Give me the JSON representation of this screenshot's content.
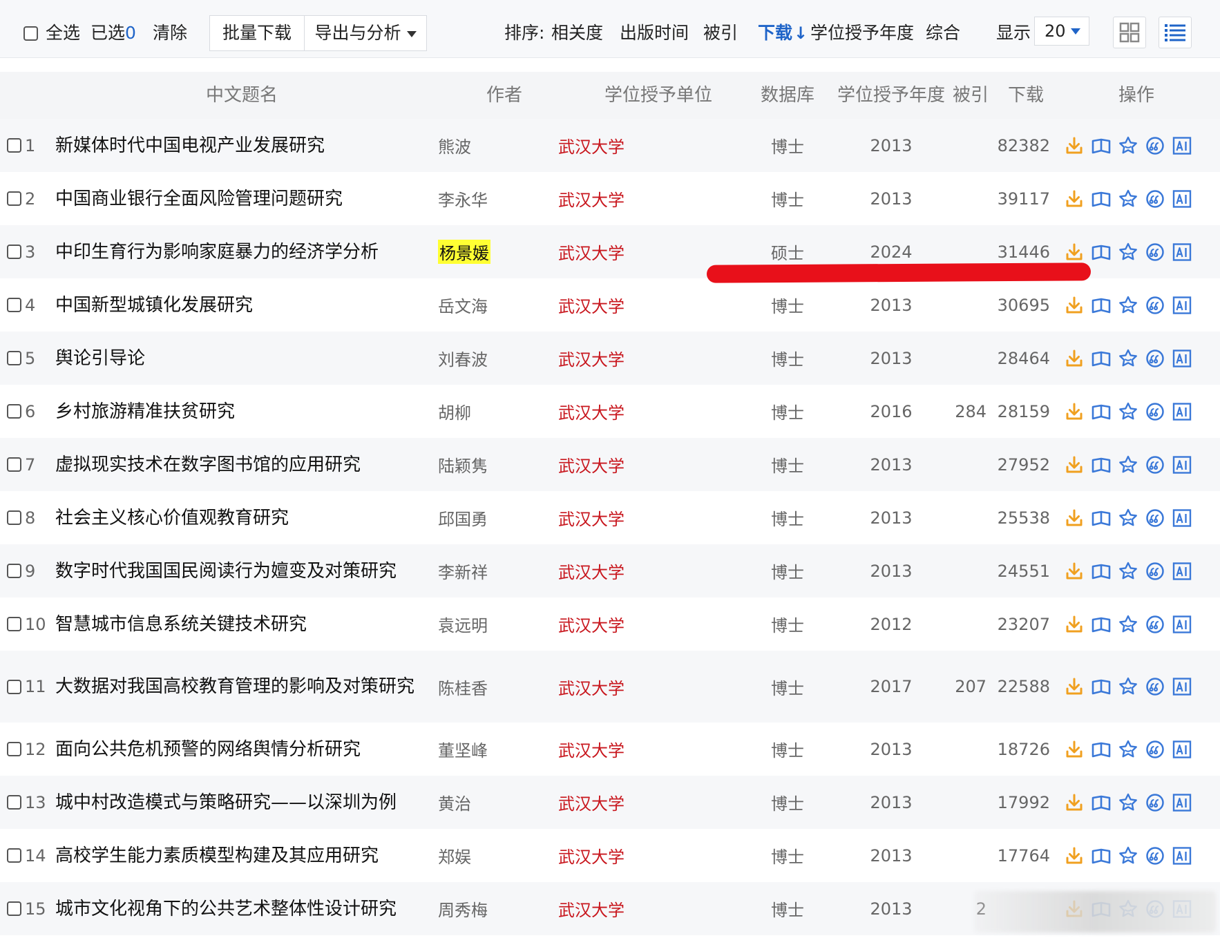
{
  "toolbar": {
    "select_all": "全选",
    "selected_label": "已选",
    "selected_count": "0",
    "clear": "清除",
    "batch_download": "批量下载",
    "export_analyze": "导出与分析",
    "sort_label": "排序:",
    "sort_options": [
      "相关度",
      "出版时间",
      "被引",
      "下载",
      "学位授予年度",
      "综合"
    ],
    "sort_active": "下载",
    "display_label": "显示",
    "page_size": "20",
    "grid_view_icon": "grid-view-icon",
    "list_view_icon": "list-view-icon"
  },
  "table": {
    "headers": {
      "title": "中文题名",
      "author": "作者",
      "unit": "学位授予单位",
      "db": "数据库",
      "year": "学位授予年度",
      "cited": "被引",
      "downloads": "下载",
      "ops": "操作"
    },
    "rows": [
      {
        "num": "1",
        "title": "新媒体时代中国电视产业发展研究",
        "author": "熊波",
        "unit": "武汉大学",
        "db": "博士",
        "year": "2013",
        "cited": "",
        "downloads": "82382"
      },
      {
        "num": "2",
        "title": "中国商业银行全面风险管理问题研究",
        "author": "李永华",
        "unit": "武汉大学",
        "db": "博士",
        "year": "2013",
        "cited": "",
        "downloads": "39117"
      },
      {
        "num": "3",
        "title": "中印生育行为影响家庭暴力的经济学分析",
        "author": "杨景媛",
        "unit": "武汉大学",
        "db": "硕士",
        "year": "2024",
        "cited": "",
        "downloads": "31446"
      },
      {
        "num": "4",
        "title": "中国新型城镇化发展研究",
        "author": "岳文海",
        "unit": "武汉大学",
        "db": "博士",
        "year": "2013",
        "cited": "",
        "downloads": "30695"
      },
      {
        "num": "5",
        "title": "舆论引导论",
        "author": "刘春波",
        "unit": "武汉大学",
        "db": "博士",
        "year": "2013",
        "cited": "",
        "downloads": "28464"
      },
      {
        "num": "6",
        "title": "乡村旅游精准扶贫研究",
        "author": "胡柳",
        "unit": "武汉大学",
        "db": "博士",
        "year": "2016",
        "cited": "284",
        "downloads": "28159"
      },
      {
        "num": "7",
        "title": "虚拟现实技术在数字图书馆的应用研究",
        "author": "陆颖隽",
        "unit": "武汉大学",
        "db": "博士",
        "year": "2013",
        "cited": "",
        "downloads": "27952"
      },
      {
        "num": "8",
        "title": "社会主义核心价值观教育研究",
        "author": "邱国勇",
        "unit": "武汉大学",
        "db": "博士",
        "year": "2013",
        "cited": "",
        "downloads": "25538"
      },
      {
        "num": "9",
        "title": "数字时代我国国民阅读行为嬗变及对策研究",
        "author": "李新祥",
        "unit": "武汉大学",
        "db": "博士",
        "year": "2013",
        "cited": "",
        "downloads": "24551"
      },
      {
        "num": "10",
        "title": "智慧城市信息系统关键技术研究",
        "author": "袁远明",
        "unit": "武汉大学",
        "db": "博士",
        "year": "2012",
        "cited": "",
        "downloads": "23207"
      },
      {
        "num": "11",
        "title": "大数据对我国高校教育管理的影响及对策研究",
        "author": "陈桂香",
        "unit": "武汉大学",
        "db": "博士",
        "year": "2017",
        "cited": "207",
        "downloads": "22588"
      },
      {
        "num": "12",
        "title": "面向公共危机预警的网络舆情分析研究",
        "author": "董坚峰",
        "unit": "武汉大学",
        "db": "博士",
        "year": "2013",
        "cited": "",
        "downloads": "18726"
      },
      {
        "num": "13",
        "title": "城中村改造模式与策略研究——以深圳为例",
        "author": "黄治",
        "unit": "武汉大学",
        "db": "博士",
        "year": "2013",
        "cited": "",
        "downloads": "17992"
      },
      {
        "num": "14",
        "title": "高校学生能力素质模型构建及其应用研究",
        "author": "郑娱",
        "unit": "武汉大学",
        "db": "博士",
        "year": "2013",
        "cited": "",
        "downloads": "17764"
      },
      {
        "num": "15",
        "title": "城市文化视角下的公共艺术整体性设计研究",
        "author": "周秀梅",
        "unit": "武汉大学",
        "db": "博士",
        "year": "2013",
        "cited": "2",
        "downloads": ""
      }
    ],
    "highlighted_author_row": 3,
    "op_icons": [
      "download-icon",
      "read-icon",
      "favorite-icon",
      "cite-icon",
      "ai-icon"
    ]
  },
  "colors": {
    "accent": "#1f64c8",
    "unit_red": "#c8161d",
    "annotation_red": "#e8101a",
    "download_orange": "#f0a020",
    "icon_blue": "#3a78d8",
    "highlight_yellow": "#ffff33"
  }
}
